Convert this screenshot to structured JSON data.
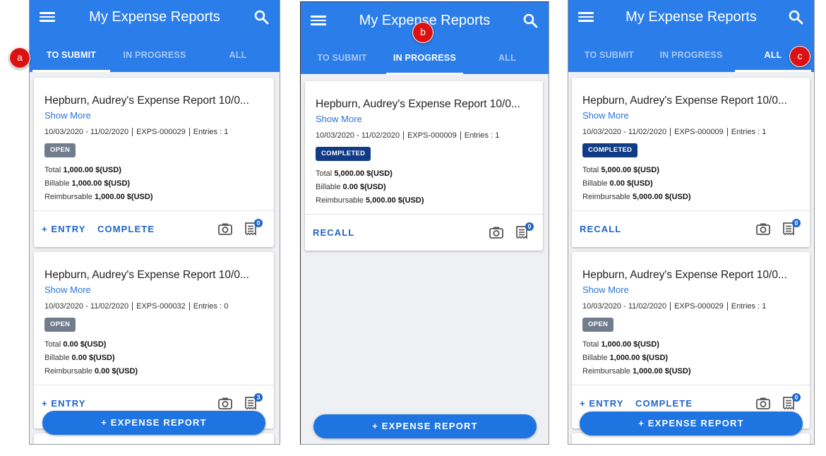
{
  "app": {
    "title": "My Expense Reports",
    "fab_label": "+ EXPENSE REPORT"
  },
  "tabs": [
    "TO SUBMIT",
    "IN PROGRESS",
    "ALL"
  ],
  "callouts": [
    "a",
    "b",
    "c"
  ],
  "labels": {
    "total": "Total",
    "billable": "Billable",
    "reimbursable": "Reimbursable",
    "show_more": "Show More"
  },
  "actions": {
    "entry": "+ ENTRY",
    "complete": "COMPLETE",
    "recall": "RECALL"
  },
  "colors": {
    "appbar": "#2b7de9",
    "open_badge": "#717d8c",
    "completed_badge": "#113b84",
    "action": "#1f64c8",
    "callout": "#dd1111"
  },
  "screens": {
    "a": {
      "active_tab": "TO SUBMIT",
      "reports": [
        {
          "title": "Hepburn, Audrey's Expense Report 10/0...",
          "date_range": "10/03/2020 - 11/02/2020",
          "id": "EXPS-000029",
          "entries": "Entries : 1",
          "status": "OPEN",
          "total": "1,000.00 $(USD)",
          "billable": "1,000.00 $(USD)",
          "reimbursable": "1,000.00 $(USD)",
          "receipt_count": "0"
        },
        {
          "title": "Hepburn, Audrey's Expense Report 10/0...",
          "date_range": "10/03/2020 - 11/02/2020",
          "id": "EXPS-000032",
          "entries": "Entries : 0",
          "status": "OPEN",
          "total": "0.00 $(USD)",
          "billable": "0.00 $(USD)",
          "reimbursable": "0.00 $(USD)",
          "receipt_count": "3"
        }
      ]
    },
    "b": {
      "active_tab": "IN PROGRESS",
      "reports": [
        {
          "title": "Hepburn, Audrey's Expense Report 10/0...",
          "date_range": "10/03/2020 - 11/02/2020",
          "id": "EXPS-000009",
          "entries": "Entries : 1",
          "status": "COMPLETED",
          "total": "5,000.00 $(USD)",
          "billable": "0.00 $(USD)",
          "reimbursable": "5,000.00 $(USD)",
          "receipt_count": "0"
        }
      ]
    },
    "c": {
      "active_tab": "ALL",
      "reports": [
        {
          "title": "Hepburn, Audrey's Expense Report 10/0...",
          "date_range": "10/03/2020 - 11/02/2020",
          "id": "EXPS-000009",
          "entries": "Entries : 1",
          "status": "COMPLETED",
          "total": "5,000.00 $(USD)",
          "billable": "0.00 $(USD)",
          "reimbursable": "5,000.00 $(USD)",
          "receipt_count": "0"
        },
        {
          "title": "Hepburn, Audrey's Expense Report 10/0...",
          "date_range": "10/03/2020 - 11/02/2020",
          "id": "EXPS-000029",
          "entries": "Entries : 1",
          "status": "OPEN",
          "total": "1,000.00 $(USD)",
          "billable": "1,000.00 $(USD)",
          "reimbursable": "1,000.00 $(USD)",
          "receipt_count": "0"
        }
      ]
    }
  }
}
